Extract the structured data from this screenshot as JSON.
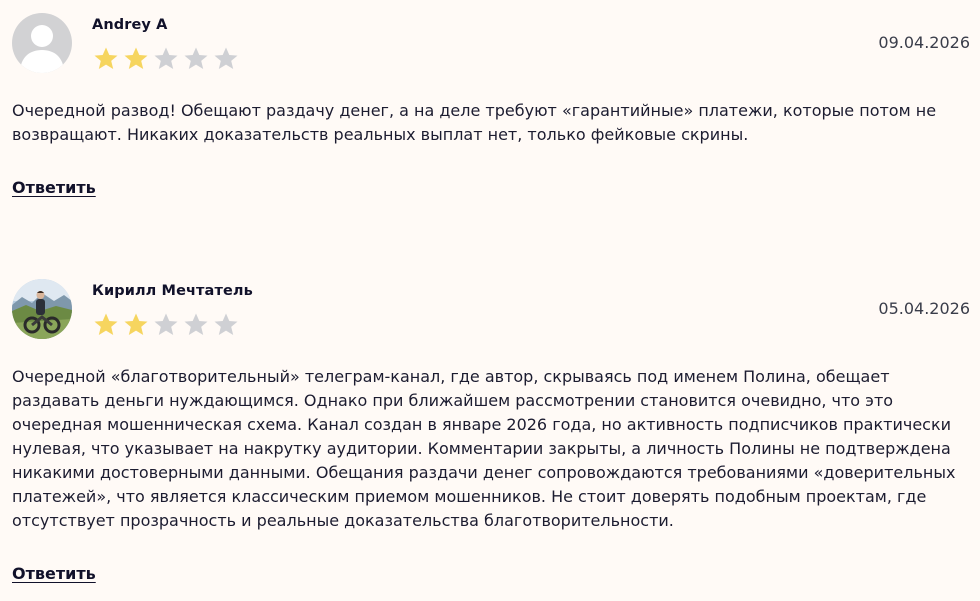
{
  "reviews": [
    {
      "author": "Andrey A",
      "date": "09.04.2026",
      "rating": 2,
      "max_rating": 5,
      "avatar": "default-user-icon",
      "text": "Очередной развод! Обещают раздачу денег, а на деле требуют «гарантийные» платежи, которые потом не возвращают. Никаких доказательств реальных выплат нет, только фейковые скрины.",
      "reply_label": "Ответить"
    },
    {
      "author": "Кирилл Мечтатель",
      "date": "05.04.2026",
      "rating": 2,
      "max_rating": 5,
      "avatar": "user-photo-motorcycle",
      "text": "Очередной «благотворительный» телеграм-канал, где автор, скрываясь под именем Полина, обещает раздавать деньги нуждающимся. Однако при ближайшем рассмотрении становится очевидно, что это очередная мошенническая схема. Канал создан в январе 2026 года, но активность подписчиков практически нулевая, что указывает на накрутку аудитории. Комментарии закрыты, а личность Полины не подтверждена никакими достоверными данными. Обещания раздачи денег сопровождаются требованиями «доверительных платежей», что является классическим приемом мошенников. Не стоит доверять подобным проектам, где отсутствует прозрачность и реальные доказательства благотворительности.",
      "reply_label": "Ответить"
    }
  ],
  "colors": {
    "background": "#fffaf6",
    "star_filled": "#f6d55f",
    "star_empty": "#cfd0d4",
    "text": "#1c1c30",
    "date": "#3a3d4a"
  }
}
